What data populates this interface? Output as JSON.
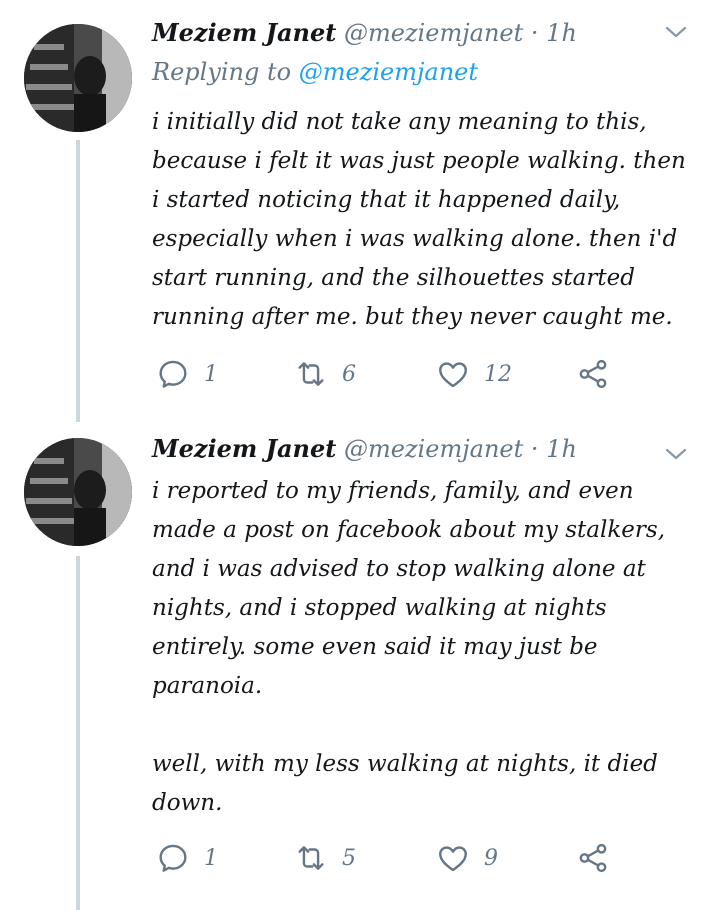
{
  "tweets": [
    {
      "author": {
        "name": "Meziem Janet",
        "handle": "@meziemjanet"
      },
      "separator": "·",
      "time": "1h",
      "replying": {
        "prefix": "Replying to",
        "handle": "@meziemjanet"
      },
      "text": "i initially did not take any meaning to this,\nbecause i felt it was just people walking. then\ni started noticing that it happened daily,\nespecially when i was walking alone. then i'd\nstart running, and the silhouettes started\nrunning after me. but they never caught me.",
      "actions": {
        "replies": "1",
        "retweets": "6",
        "likes": "12"
      }
    },
    {
      "author": {
        "name": "Meziem Janet",
        "handle": "@meziemjanet"
      },
      "separator": "·",
      "time": "1h",
      "text": "i reported to my friends, family, and even\nmade a post on facebook about my stalkers,\nand i was advised to stop walking alone at\nnights, and i stopped walking at nights\nentirely. some even said it may just be\nparanoia.\n\nwell, with my less walking at nights, it died\ndown.",
      "actions": {
        "replies": "1",
        "retweets": "5",
        "likes": "9"
      }
    }
  ],
  "colors": {
    "text": "#14171a",
    "muted": "#657786",
    "link": "#1da1f2",
    "thread_line": "#ccd6dd"
  },
  "icons": [
    "reply-icon",
    "retweet-icon",
    "like-icon",
    "share-icon",
    "chevron-down-icon"
  ]
}
